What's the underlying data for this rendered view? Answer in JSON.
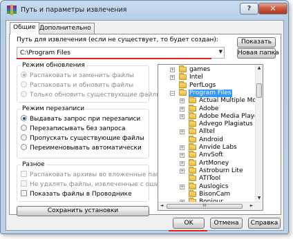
{
  "window": {
    "title": "Путь и параметры извлечения",
    "help_label": "?",
    "close_label": "✕"
  },
  "tabs": [
    {
      "label": "Общие",
      "active": true
    },
    {
      "label": "Дополнительно",
      "active": false
    }
  ],
  "path": {
    "label": "Путь для извлечения (если не существует, то будет создан):",
    "value": "C:\\Program Files",
    "show_button": "Показать",
    "new_folder_button": "Новая папка"
  },
  "update_mode": {
    "title": "Режим обновления",
    "options": [
      {
        "label": "Распаковать и заменить файлы",
        "checked": true,
        "disabled": true
      },
      {
        "label": "Распаковать и обновить файлы",
        "checked": false,
        "disabled": true
      },
      {
        "label": "Только обновить существующие файлы",
        "checked": false,
        "disabled": true
      }
    ]
  },
  "overwrite_mode": {
    "title": "Режим перезаписи",
    "options": [
      {
        "label": "Выдавать запрос при перезаписи",
        "checked": true,
        "disabled": false
      },
      {
        "label": "Перезаписывать без запроса",
        "checked": false,
        "disabled": false
      },
      {
        "label": "Пропускать существующие файлы",
        "checked": false,
        "disabled": false
      },
      {
        "label": "Переименовывать автоматически",
        "checked": false,
        "disabled": false
      }
    ]
  },
  "misc": {
    "title": "Разное",
    "options": [
      {
        "label": "Распаковать архивы во вложенные папки",
        "checked": false,
        "disabled": true
      },
      {
        "label": "Не удалять файлы, извлеченные с ошибками",
        "checked": false,
        "disabled": true
      },
      {
        "label": "Показать файлы в Проводнике",
        "checked": false,
        "disabled": false
      }
    ]
  },
  "save_settings_button": "Сохранить установки",
  "tree": {
    "items": [
      {
        "label": "games",
        "level": 1,
        "expander": "+",
        "selected": false
      },
      {
        "label": "Intel",
        "level": 1,
        "expander": "+",
        "selected": false
      },
      {
        "label": "PerfLogs",
        "level": 1,
        "expander": "",
        "selected": false
      },
      {
        "label": "Program Files",
        "level": 1,
        "expander": "−",
        "selected": true
      },
      {
        "label": "Actual Multiple Monitors",
        "level": 2,
        "expander": "+",
        "selected": false
      },
      {
        "label": "Adobe",
        "level": 2,
        "expander": "+",
        "selected": false
      },
      {
        "label": "Adobe Media Player",
        "level": 2,
        "expander": "+",
        "selected": false
      },
      {
        "label": "Advego Plagiatus",
        "level": 2,
        "expander": "",
        "selected": false
      },
      {
        "label": "Alltel",
        "level": 2,
        "expander": "+",
        "selected": false
      },
      {
        "label": "Android",
        "level": 2,
        "expander": "",
        "selected": false
      },
      {
        "label": "Anvide Labs",
        "level": 2,
        "expander": "+",
        "selected": false
      },
      {
        "label": "AnvSoft",
        "level": 2,
        "expander": "+",
        "selected": false
      },
      {
        "label": "ArtMoney",
        "level": 2,
        "expander": "+",
        "selected": false
      },
      {
        "label": "Astroburn Lite",
        "level": 2,
        "expander": "+",
        "selected": false
      },
      {
        "label": "ATITool",
        "level": 2,
        "expander": "",
        "selected": false
      },
      {
        "label": "Auslogics",
        "level": 2,
        "expander": "+",
        "selected": false
      },
      {
        "label": "BisonCam",
        "level": 2,
        "expander": "",
        "selected": false
      },
      {
        "label": "Bonjour",
        "level": 2,
        "expander": "+",
        "selected": false
      }
    ],
    "hscroll_grip": "III"
  },
  "footer": {
    "ok_label": "OK",
    "cancel_label": "Отмена",
    "help_label": "Справка"
  },
  "colors": {
    "highlight_underline": "#e1211b",
    "selection": "#3399ff"
  }
}
